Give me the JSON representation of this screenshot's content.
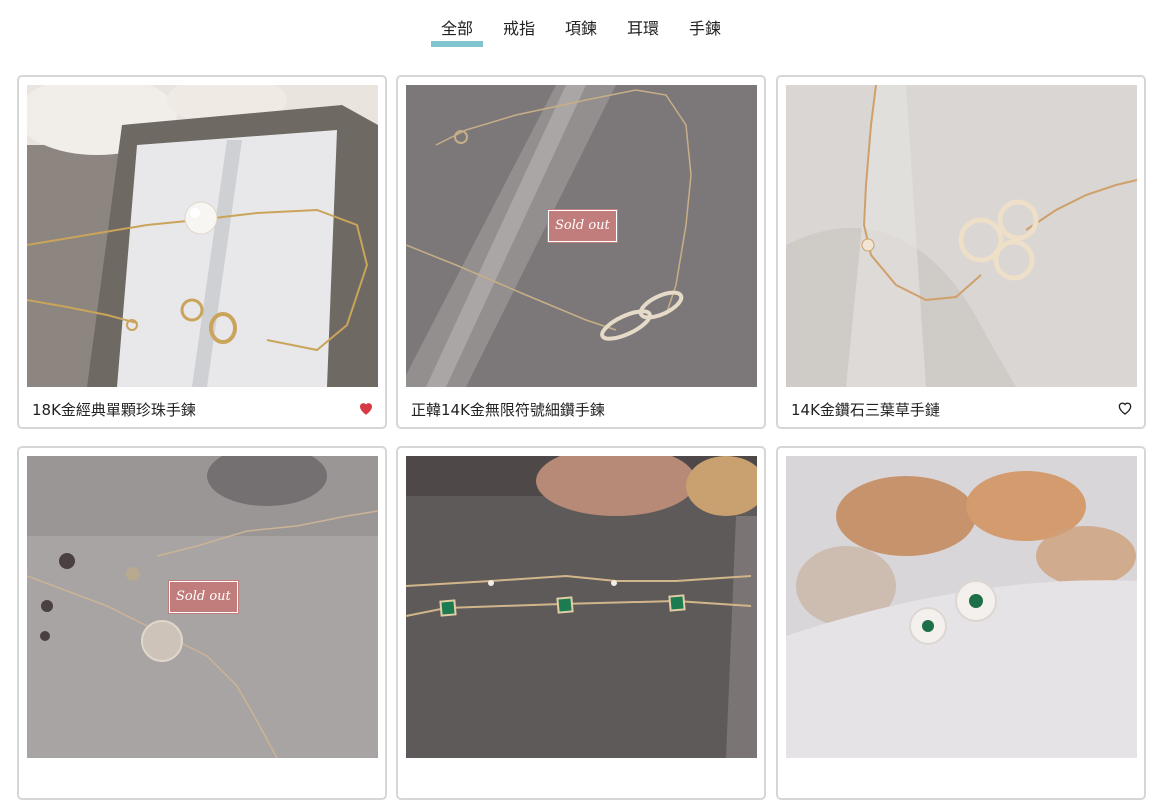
{
  "tabs": [
    {
      "label": "全部",
      "active": true
    },
    {
      "label": "戒指",
      "active": false
    },
    {
      "label": "項鍊",
      "active": false
    },
    {
      "label": "耳環",
      "active": false
    },
    {
      "label": "手鍊",
      "active": false
    }
  ],
  "products": [
    {
      "name": "18K金經典單顆珍珠手鍊",
      "favorited": true,
      "sold_out": false
    },
    {
      "name": "正韓14K金無限符號細鑽手鍊",
      "favorited": false,
      "sold_out": true,
      "badge": "Sold out"
    },
    {
      "name": "14K金鑽石三葉草手鏈",
      "favorited": false,
      "sold_out": false
    },
    {
      "name": "",
      "favorited": false,
      "sold_out": true,
      "badge": "Sold out"
    },
    {
      "name": "",
      "favorited": false,
      "sold_out": false
    },
    {
      "name": "",
      "favorited": false,
      "sold_out": false
    }
  ],
  "colors": {
    "tab_underline": "#7fc4cf",
    "heart_filled": "#d63a45",
    "sold_out_badge": "#c07d7b"
  }
}
